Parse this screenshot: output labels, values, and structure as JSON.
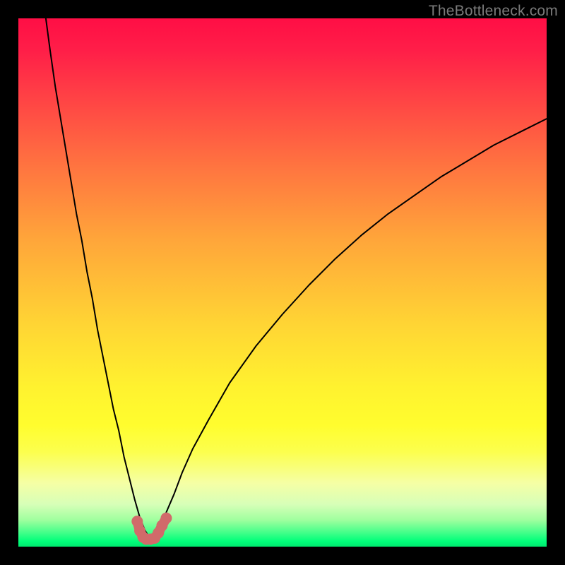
{
  "watermark": "TheBottleneck.com",
  "chart_data": {
    "type": "line",
    "title": "",
    "xlabel": "",
    "ylabel": "",
    "xlim": [
      0,
      100
    ],
    "ylim": [
      0,
      100
    ],
    "series": [
      {
        "name": "bottleneck-curve",
        "x": [
          5.2,
          6,
          7,
          8,
          9,
          10,
          11,
          12,
          13,
          14,
          15,
          16,
          17,
          18,
          19,
          20,
          21,
          22,
          23,
          24,
          25,
          26,
          27,
          28,
          29.5,
          31,
          33,
          36,
          40,
          45,
          50,
          55,
          60,
          65,
          70,
          75,
          80,
          85,
          90,
          95,
          100
        ],
        "y": [
          100,
          94,
          87,
          81,
          75,
          69,
          63,
          58,
          52,
          47,
          41,
          36,
          31,
          26,
          22,
          17,
          13,
          9,
          5.5,
          3,
          1.5,
          1.5,
          3.5,
          6.5,
          10,
          14,
          18.5,
          24,
          31,
          38,
          44,
          49.5,
          54.5,
          59,
          63,
          66.5,
          70,
          73,
          76,
          78.5,
          81
        ]
      }
    ],
    "highlight": {
      "name": "trough-highlight",
      "color": "#d16a6a",
      "x": [
        22.5,
        23,
        23.6,
        24.2,
        25,
        25.8,
        26.5,
        27.2,
        28
      ],
      "y": [
        4.8,
        3,
        1.8,
        1.4,
        1.4,
        1.6,
        2.6,
        4,
        5.4
      ]
    }
  }
}
